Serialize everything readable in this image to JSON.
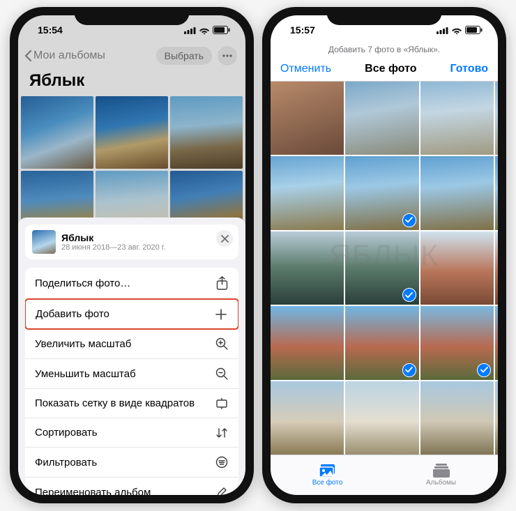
{
  "watermark": "ЯБЛЫК",
  "left": {
    "time": "15:54",
    "back_label": "Мои альбомы",
    "select_label": "Выбрать",
    "album_title": "Яблык",
    "sheet": {
      "title": "Яблык",
      "subtitle": "28 июня 2018—23 авг. 2020 г."
    },
    "menu": [
      {
        "label": "Поделиться фото…",
        "icon": "share-icon"
      },
      {
        "label": "Добавить фото",
        "icon": "plus-icon",
        "highlight": true
      },
      {
        "label": "Увеличить масштаб",
        "icon": "zoom-in-icon"
      },
      {
        "label": "Уменьшить масштаб",
        "icon": "zoom-out-icon"
      },
      {
        "label": "Показать сетку в виде квадратов",
        "icon": "aspect-icon"
      },
      {
        "label": "Сортировать",
        "icon": "sort-icon"
      },
      {
        "label": "Фильтровать",
        "icon": "filter-icon"
      },
      {
        "label": "Переименовать альбом",
        "icon": "rename-icon"
      }
    ],
    "thumbs": [
      "linear-gradient(160deg,#2d6fb0 0%,#57a7e0 40%,#b6d6ec 65%,#7a6a50 100%)",
      "linear-gradient(170deg,#1a5fa3 0%,#3a8cd0 40%,#cfb57a 65%,#7a5a34 100%)",
      "linear-gradient(175deg,#6fb6e5 0%,#a6d4ef 40%,#8f7a55 70%,#5a4a30 100%)",
      "linear-gradient(175deg,#2f74b5 0%,#5ea4de 40%,#b19a55 70%,#5f5030 100%)",
      "linear-gradient(175deg,#6fb6e5 0%,#c8e4f3 40%,#e7e2d0 70%,#b5a87a 100%)",
      "linear-gradient(170deg,#2a6aad 0%,#4e96d6 35%,#a58a55 65%,#4a3a25 100%)"
    ]
  },
  "right": {
    "time": "15:57",
    "header_sub": "Добавить 7 фото в «Яблык».",
    "cancel": "Отменить",
    "title": "Все фото",
    "done": "Готово",
    "tabs": {
      "all": "Все фото",
      "albums": "Альбомы"
    },
    "cells": [
      {
        "bg": "linear-gradient(160deg,#b88a6a,#6a4a3a)",
        "sel": false
      },
      {
        "bg": "linear-gradient(170deg,#7aa8c8,#b0c8d8 40%,#8a8a7a)",
        "sel": false
      },
      {
        "bg": "linear-gradient(175deg,#8fb8d5,#c3d6e2 40%,#a09a82)",
        "sel": false
      },
      {
        "bg": "linear-gradient(175deg,#8fb8d5,#c0d4e0 40%,#9c967f)",
        "sel": false
      },
      {
        "bg": "linear-gradient(175deg,#66a4d2,#a8d0e8 40%,#8a7a4d)",
        "sel": false
      },
      {
        "bg": "linear-gradient(175deg,#5fa0d0,#9cc8e5 40%,#7f6f45)",
        "sel": true
      },
      {
        "bg": "linear-gradient(175deg,#5fa0d0,#9cc8e5 40%,#7f6f45)",
        "sel": false
      },
      {
        "bg": "linear-gradient(175deg,#5fa0d0,#9cc8e5 40%,#7f6f45)",
        "sel": true
      },
      {
        "bg": "linear-gradient(180deg,#b8ccd8 0%,#5a7a6a 50%,#2a3f3a 100%)",
        "sel": false
      },
      {
        "bg": "linear-gradient(180deg,#b8ccd8 0%,#5a7a6a 50%,#2a3f3a 100%)",
        "sel": true
      },
      {
        "bg": "linear-gradient(180deg,#cfe3ef 0%,#b8755a 55%,#7a4a35 100%)",
        "sel": false
      },
      {
        "bg": "linear-gradient(180deg,#cfe3ef 0%,#b8755a 55%,#7a4a35 100%)",
        "sel": false
      },
      {
        "bg": "linear-gradient(180deg,#6fb6e5 0%,#b86a50 55%,#5a6a3a 100%)",
        "sel": false
      },
      {
        "bg": "linear-gradient(180deg,#6fb6e5 0%,#b86a50 55%,#5a6a3a 100%)",
        "sel": true
      },
      {
        "bg": "linear-gradient(180deg,#7ab8e0 0%,#b86a50 55%,#5a6a3a 100%)",
        "sel": true
      },
      {
        "bg": "linear-gradient(180deg,#7ab8e0 0%,#b86a50 55%,#5a6a3a 100%)",
        "sel": true
      },
      {
        "bg": "linear-gradient(180deg,#a8c8df 0%,#d6ccb8 55%,#8a7a55 100%)",
        "sel": false
      },
      {
        "bg": "linear-gradient(180deg,#bcd4e4 0%,#e4ded0 55%,#9a8f6f 100%)",
        "sel": false
      },
      {
        "bg": "linear-gradient(180deg,#a8c8df 0%,#d0c8b5 55%,#7f7455 100%)",
        "sel": false
      },
      {
        "bg": "linear-gradient(180deg,#a8c8df 0%,#d0c8b5 55%,#7f7455 100%)",
        "sel": true
      }
    ]
  }
}
